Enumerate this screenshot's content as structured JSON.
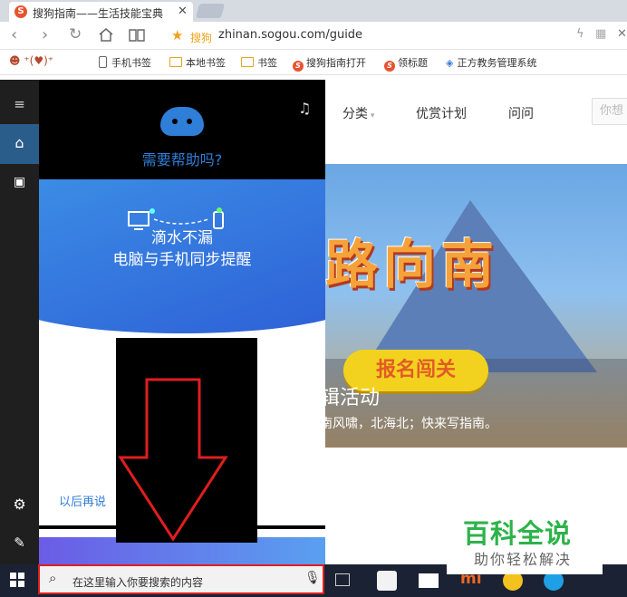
{
  "browser": {
    "tab_title": "搜狗指南——生活技能宝典",
    "tab_favicon": "S",
    "address_label": "搜狗",
    "url": "zhinan.sogou.com/guide"
  },
  "bookmarks": [
    {
      "label": "手机书签",
      "icon": "phone-icon"
    },
    {
      "label": "本地书签",
      "icon": "folder-icon"
    },
    {
      "label": "书签",
      "icon": "folder-icon"
    },
    {
      "label": "搜狗指南打开",
      "icon": "sogou-icon"
    },
    {
      "label": "领标题",
      "icon": "sogou-icon"
    },
    {
      "label": "正方教务管理系统",
      "icon": "cube-icon"
    }
  ],
  "site_nav": {
    "items": [
      "分类",
      "优赏计划",
      "问问"
    ],
    "search_placeholder": "你想"
  },
  "banner": {
    "title": "路向南",
    "button": "报名闯关",
    "headline": "辑活动",
    "subline": "南风啸，北海北；快来写指南。"
  },
  "cortana": {
    "help": "需要帮助吗?",
    "line1": "滴水不漏",
    "line2": "电脑与手机同步提醒",
    "later": "以后再说"
  },
  "taskbar": {
    "search_placeholder": "在这里输入你要搜索的内容"
  },
  "watermark": {
    "title": "百科全说",
    "subtitle": "助你轻松解决"
  },
  "colors": {
    "accent_blue": "#2f7ed8",
    "highlight_red": "#e01e1e",
    "watermark_green": "#2db34a"
  }
}
